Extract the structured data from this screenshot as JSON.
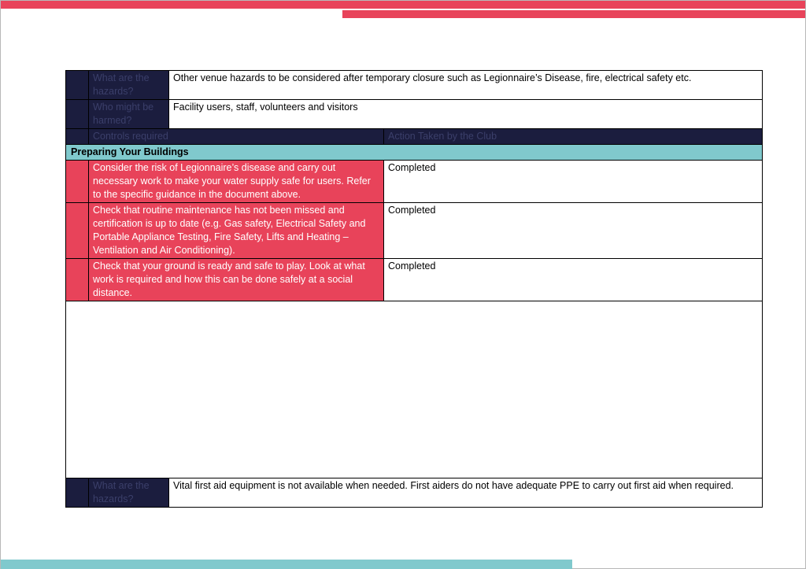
{
  "rows": {
    "hazard1": {
      "label": "What are the hazards?",
      "text": "Other venue hazards to be considered after temporary closure such as Legionnaire’s Disease, fire, electrical safety etc."
    },
    "harmed": {
      "label": "Who might be harmed?",
      "text": "Facility users, staff, volunteers and visitors"
    },
    "header": {
      "controls": "Controls required",
      "action": "Action Taken by the Club"
    },
    "section": "Preparing Your Buildings",
    "controls": [
      {
        "text": "Consider the risk of Legionnaire’s disease and carry out necessary work to make your water supply safe for users. Refer to the specific guidance in the document above.",
        "action": "Completed"
      },
      {
        "text": "Check that routine maintenance has not been missed and certification is up to date (e.g. Gas safety, Electrical Safety and Portable Appliance Testing, Fire Safety, Lifts and Heating – Ventilation and Air Conditioning).",
        "action": "Completed"
      },
      {
        "text": "Check that your ground is ready and safe to play.  Look at what work is required and how this can be done safely at a social distance.",
        "action": "Completed"
      }
    ],
    "hazard2": {
      "label": "What are the hazards?",
      "text": "Vital first aid equipment is not available when needed.  First aiders do not have adequate PPE to carry out first aid when required."
    }
  },
  "colors": {
    "navy": "#1b1d3e",
    "red": "#e8435a",
    "teal": "#80c9cd"
  }
}
